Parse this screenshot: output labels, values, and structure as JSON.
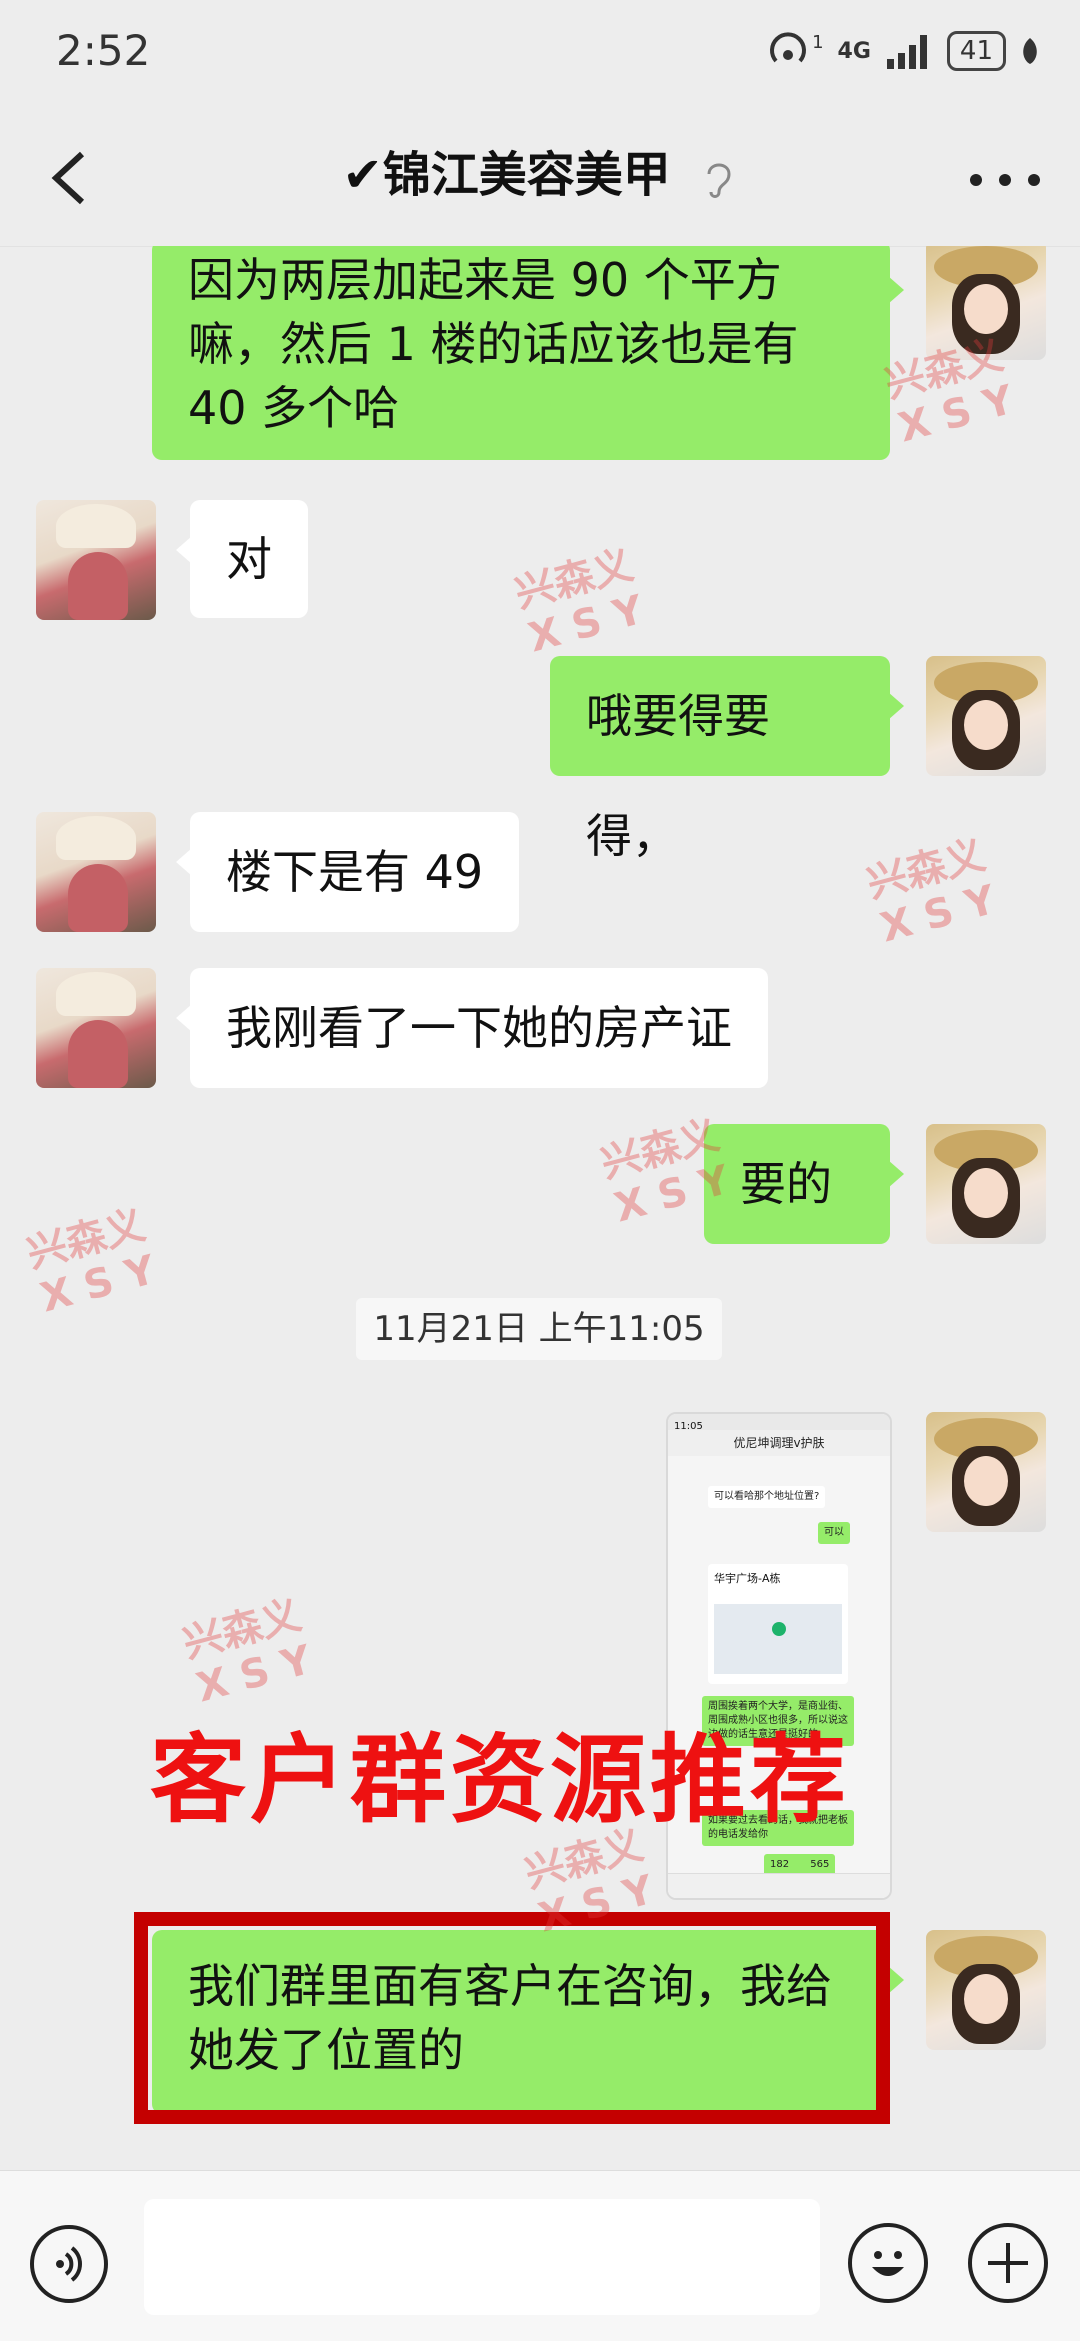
{
  "status_bar": {
    "time": "2:52",
    "signal_label": "4G",
    "sim_index": "1",
    "battery": "41"
  },
  "header": {
    "title": "✔锦江美容美甲",
    "back_icon": "chevron-left-icon",
    "more_icon": "more-dots-icon"
  },
  "messages": [
    {
      "from": "me",
      "text": "因为两层加起来是 90 个平方嘛，然后 1 楼的话应该也是有40 多个哈"
    },
    {
      "from": "other",
      "text": "对"
    },
    {
      "from": "me",
      "text": "哦要得要得，"
    },
    {
      "from": "other",
      "text": "楼下是有 49"
    },
    {
      "from": "other",
      "text": "我刚看了一下她的房产证"
    },
    {
      "from": "me",
      "text": "要的"
    },
    {
      "from": "me",
      "text": "我们群里面有客户在咨询，我给她发了位置的"
    }
  ],
  "timestamp": "11月21日 上午11:05",
  "screenshot_message": {
    "time": "11:05",
    "title": "优尼坤调理v护肤",
    "q1": "可以看哈那个地址位置?",
    "a1": "可以",
    "location_title": "华宇广场-A栋",
    "note1": "周围挨着两个大学，是商业街、周围成熟小区也很多，所以说这边做的话生意还是挺好的",
    "note2": "如果要过去看的话，我就把老板的电话发给你",
    "phone": "182",
    "phone_tail": "565"
  },
  "overlay": {
    "promo_text": "客户群资源推荐",
    "watermark_line1": "兴森义",
    "watermark_line2": "X S Y"
  },
  "input_bar": {
    "voice_icon": "voice-icon",
    "emoji_icon": "emoji-icon",
    "plus_icon": "plus-icon"
  },
  "colors": {
    "me_bubble": "#95ec69",
    "other_bubble": "#ffffff",
    "promo": "#ee1111",
    "highlight_border": "#c40000"
  }
}
